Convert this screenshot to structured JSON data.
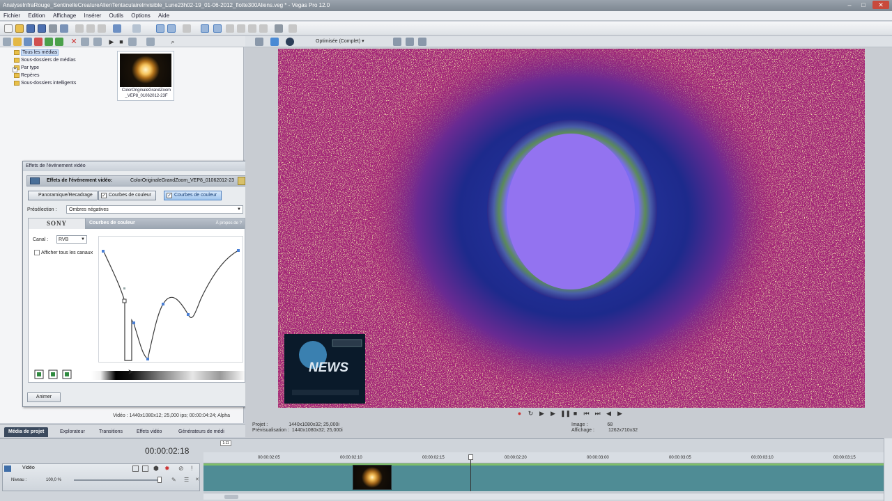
{
  "window": {
    "title": "AnalyseInfraRouge_SentinelleCreatureAlienTentaculaireInvisible_Lune23h02-19_01-06-2012_flotte300Aliens.veg * - Vegas Pro 12.0"
  },
  "menu": [
    "Fichier",
    "Edition",
    "Affichage",
    "Insérer",
    "Outils",
    "Options",
    "Aide"
  ],
  "media_tree": [
    {
      "label": "Tous les médias",
      "selected": true
    },
    {
      "label": "Sous-dossiers de médias",
      "selected": false
    },
    {
      "label": "Par type",
      "selected": false
    },
    {
      "label": "Repères",
      "selected": false
    },
    {
      "label": "Sous-dossiers intelligents",
      "selected": false
    }
  ],
  "media_thumb": {
    "caption": "ColorOriginaleGrandZoom _VEP8_01062012-23F"
  },
  "dialog": {
    "title": "Effets de l'événement vidéo",
    "header_label": "Effets de l'événement vidéo:",
    "header_value": "ColorOriginaleGrandZoom_VEP8_01062012-23",
    "chain": [
      "Panoramique/Recadrage",
      "Courbes de couleur",
      "Courbes de couleur"
    ],
    "preset_label": "Présélection :",
    "preset_value": "Ombres négatives",
    "plugin_brand": "SONY",
    "plugin_name": "Courbes de couleur",
    "about": "À propos de",
    "canal_label": "Canal :",
    "canal_value": "RVB",
    "show_all": "Afficher tous les canaux",
    "animate": "Animer"
  },
  "video_info": "Vidéo : 1440x1080x12; 25,000 ips; 00:00:04:24; Alpha",
  "tabs": [
    "Média de projet",
    "Explorateur",
    "Transitions",
    "Effets vidéo",
    "Générateurs de médi"
  ],
  "preview": {
    "quality": "Optimisée (Complet)",
    "project_label": "Projet :",
    "project_value": "1440x1080x32; 25,000i",
    "preview_label": "Prévisualisation :",
    "preview_value": "1440x1080x32; 25,000i",
    "image_label": "Image :",
    "image_value": "68",
    "display_label": "Affichage :",
    "display_value": "1262x710x32"
  },
  "overlay": {
    "news": "NEWS"
  },
  "timeline": {
    "timecode": "00:00:02:18",
    "marker": "1:11",
    "ruler": [
      "00:00:02:05",
      "00:00:02:10",
      "00:00:02:15",
      "00:00:02:20",
      "00:00:03:00",
      "00:00:03:05",
      "00:00:03:10",
      "00:00:03:15"
    ],
    "track_name": "Vidéo",
    "level_label": "Niveau :",
    "level_value": "100,0 %"
  },
  "colors": {
    "accent": "#3b4a5e",
    "track": "#4f8c95",
    "curve": "#3a3a3a",
    "point": "#4a7fd4"
  }
}
